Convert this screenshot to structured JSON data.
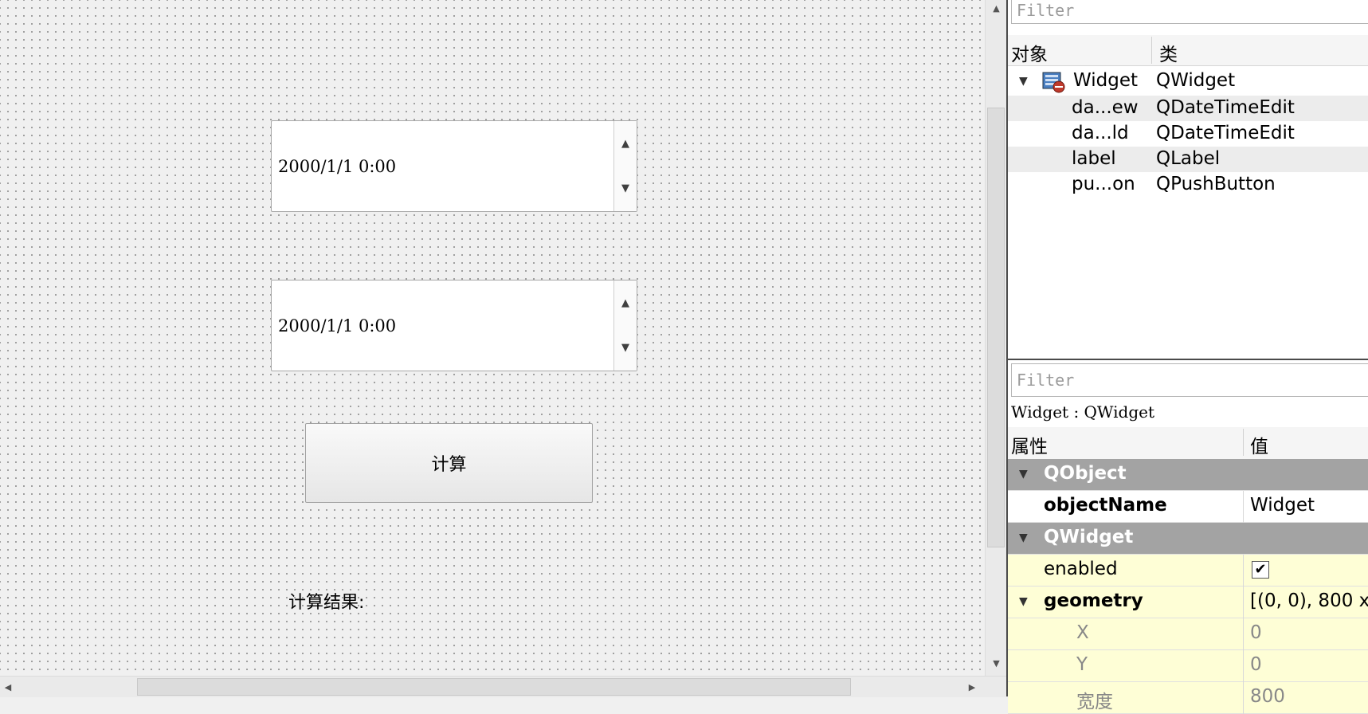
{
  "canvas": {
    "datetime_edits": [
      {
        "value": "2000/1/1 0:00"
      },
      {
        "value": "2000/1/1 0:00"
      }
    ],
    "push_button": {
      "label": "计算"
    },
    "result_label": {
      "text": "计算结果:"
    }
  },
  "object_inspector": {
    "filter_placeholder": "Filter",
    "columns": {
      "object": "对象",
      "class": "类"
    },
    "rows": [
      {
        "name": "Widget",
        "cls": "QWidget"
      },
      {
        "name": "da...ew",
        "cls": "QDateTimeEdit"
      },
      {
        "name": "da...ld",
        "cls": "QDateTimeEdit"
      },
      {
        "name": "label",
        "cls": "QLabel"
      },
      {
        "name": "pu...on",
        "cls": "QPushButton"
      }
    ]
  },
  "property_editor": {
    "filter_placeholder": "Filter",
    "title": "Widget : QWidget",
    "columns": {
      "property": "属性",
      "value": "值"
    },
    "groups": {
      "qobject": "QObject",
      "qwidget": "QWidget"
    },
    "props": {
      "objectName": {
        "name": "objectName",
        "value": "Widget"
      },
      "enabled": {
        "name": "enabled",
        "checked": true,
        "check_glyph": "✔"
      },
      "geometry": {
        "name": "geometry",
        "value": "[(0, 0), 800 x"
      },
      "x": {
        "name": "X",
        "value": "0"
      },
      "y": {
        "name": "Y",
        "value": "0"
      },
      "width": {
        "name": "宽度",
        "value": "800"
      }
    }
  },
  "icons": {
    "spin_up": "▲",
    "spin_down": "▼",
    "expand": "▼",
    "scroll_up": "▲",
    "scroll_down": "▼",
    "scroll_left": "◀",
    "scroll_right": "▶"
  }
}
